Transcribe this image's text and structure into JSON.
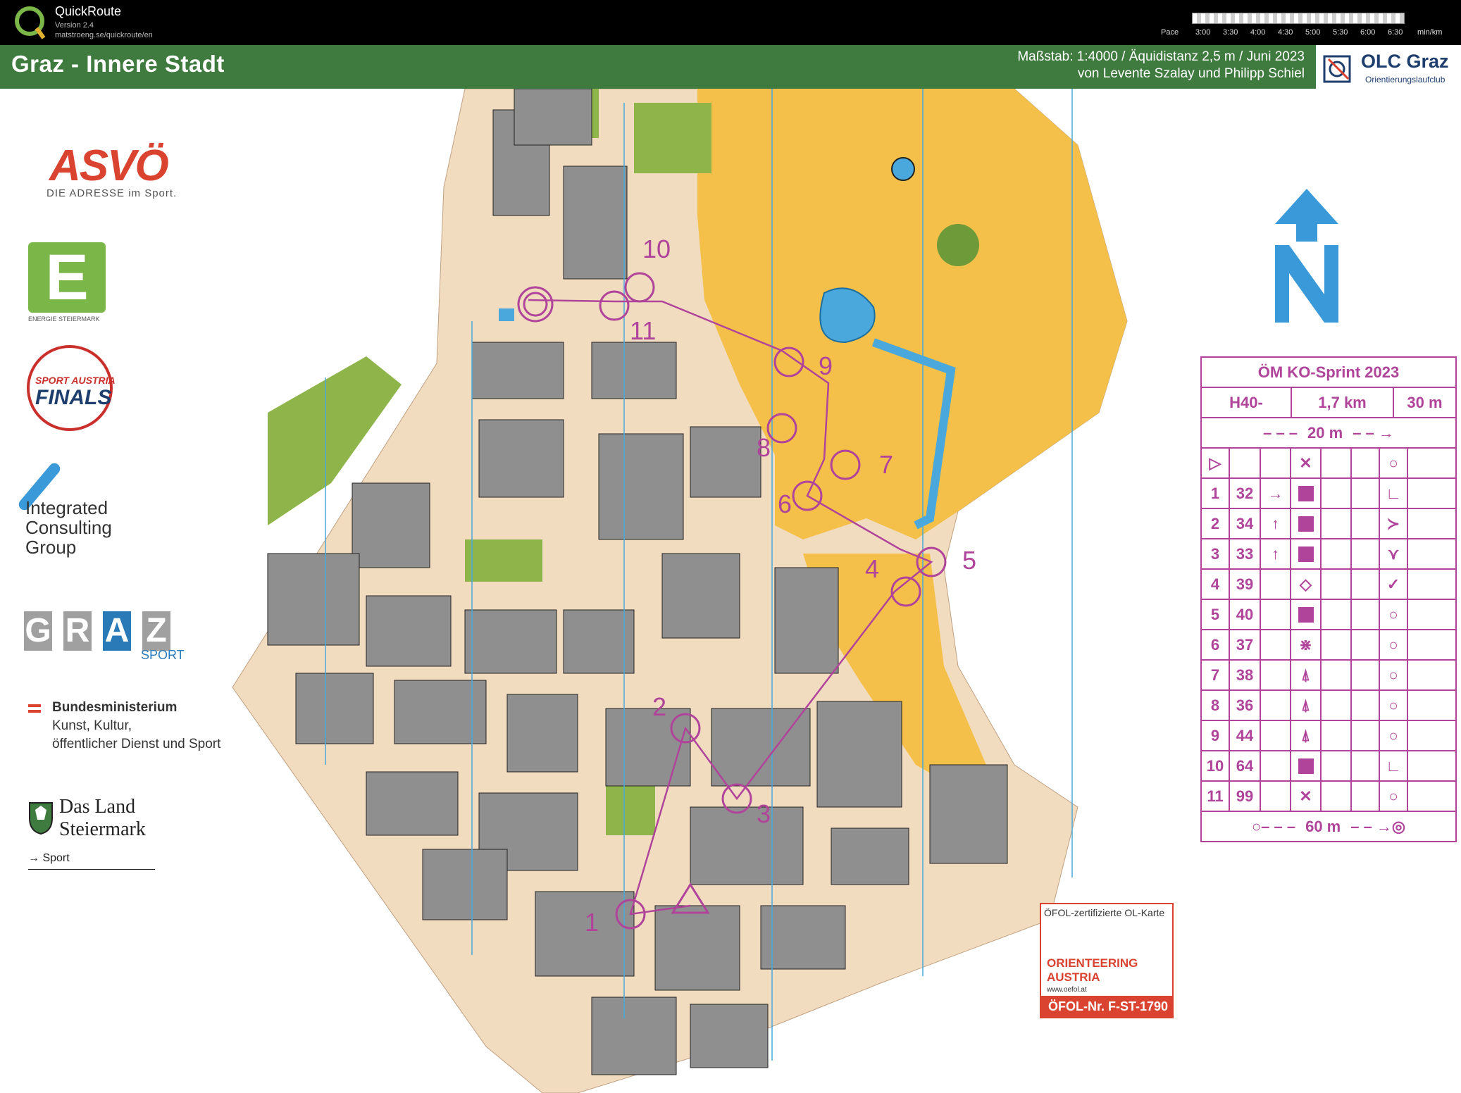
{
  "app": {
    "name": "QuickRoute",
    "version": "Version 2.4",
    "url": "matstroeng.se/quickroute/en",
    "pace_label": "Pace",
    "pace_ticks": [
      "3:00",
      "3:30",
      "4:00",
      "4:30",
      "5:00",
      "5:30",
      "6:00",
      "6:30"
    ],
    "pace_unit": "min/km"
  },
  "map": {
    "title": "Graz - Innere Stadt",
    "scale_line1": "Maßstab: 1:4000 / Äquidistanz 2,5 m / Juni 2023",
    "scale_line2": "von Levente Szalay und Philipp Schiel",
    "club_name": "OLC Graz",
    "club_sub": "Orientierungslaufclub",
    "colors": {
      "header_green": "#3f7b3f",
      "open_land": "#f4c04a",
      "building": "#8f8f8f",
      "paved": "#f1dcc0",
      "forest_green": "#8fb54a",
      "course_purple": "#b0449a",
      "water": "#4aa8dc"
    },
    "control_labels": [
      "1",
      "2",
      "3",
      "4",
      "5",
      "6",
      "7",
      "8",
      "9",
      "10",
      "11"
    ]
  },
  "sponsors": {
    "asvo": "ASVÖ",
    "asvo_sub": "DIE ADRESSE im Sport.",
    "energie_letter": "E",
    "energie_sub": "ENERGIE STEIERMARK",
    "finals_top": "SPORT AUSTRIA",
    "finals_main": "FINALS",
    "icg_line1": "Integrated",
    "icg_line2": "Consulting",
    "icg_line3": "Group",
    "graz_letters": [
      "G",
      "R",
      "A",
      "Z"
    ],
    "graz_sub": "SPORT",
    "bm_line1": "Bundesministerium",
    "bm_line2": "Kunst, Kultur,",
    "bm_line3": "öffentlicher Dienst und Sport",
    "stm_line1": "Das Land",
    "stm_line2": "Steiermark",
    "stm_sport": "→ Sport"
  },
  "description": {
    "title": "ÖM KO-Sprint 2023",
    "category": "H40-",
    "length": "1,7 km",
    "climb": "30 m",
    "start_tape": "20 m",
    "finish_tape": "60 m",
    "controls": [
      {
        "no": "1",
        "code": "32"
      },
      {
        "no": "2",
        "code": "34"
      },
      {
        "no": "3",
        "code": "33"
      },
      {
        "no": "4",
        "code": "39"
      },
      {
        "no": "5",
        "code": "40"
      },
      {
        "no": "6",
        "code": "37"
      },
      {
        "no": "7",
        "code": "38"
      },
      {
        "no": "8",
        "code": "36"
      },
      {
        "no": "9",
        "code": "44"
      },
      {
        "no": "10",
        "code": "64"
      },
      {
        "no": "11",
        "code": "99"
      }
    ]
  },
  "oefol": {
    "top": "ÖFOL-zertifizierte OL-Karte",
    "mid": "ORIENTEERING AUSTRIA",
    "www": "www.oefol.at",
    "nr": "ÖFOL-Nr. F-ST-1790"
  }
}
